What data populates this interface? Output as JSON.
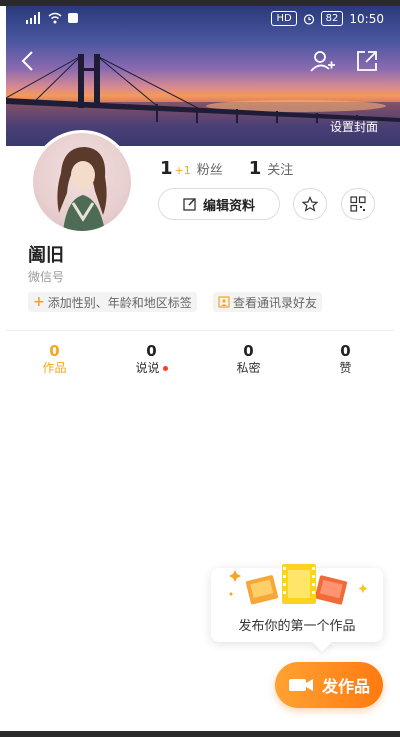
{
  "status_bar": {
    "time": "10:50",
    "battery": "82",
    "hd": "HD"
  },
  "cover": {
    "set_cover_label": "设置封面"
  },
  "profile": {
    "followers_count": "1",
    "followers_delta": "+1",
    "followers_label": "粉丝",
    "following_count": "1",
    "following_label": "关注",
    "edit_label": "编辑资料",
    "username": "阖旧",
    "wechat_label": "微信号",
    "tags": [
      {
        "icon": "plus-icon",
        "label": "添加性别、年龄和地区标签"
      },
      {
        "icon": "contacts-icon",
        "label": "查看通讯录好友"
      }
    ]
  },
  "tabs": [
    {
      "count": "0",
      "label": "作品"
    },
    {
      "count": "0",
      "label": "说说"
    },
    {
      "count": "0",
      "label": "私密"
    },
    {
      "count": "0",
      "label": "赞"
    }
  ],
  "publish": {
    "bubble_text": "发布你的第一个作品",
    "button_label": "发作品"
  },
  "colors": {
    "accent": "#f5a623",
    "button_gradient_start": "#ffa233",
    "button_gradient_end": "#ff7a10"
  }
}
